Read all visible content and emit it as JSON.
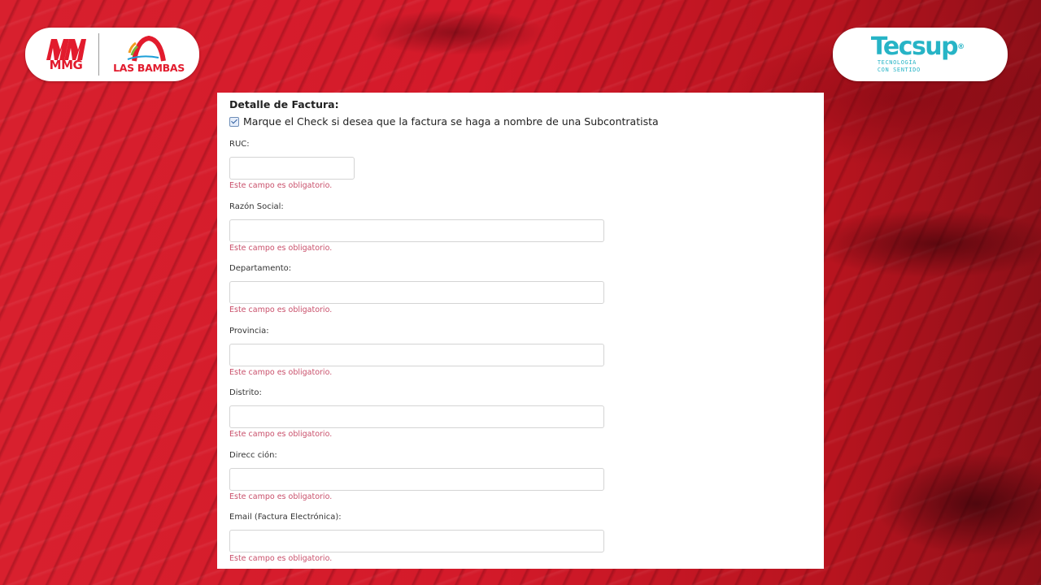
{
  "logos": {
    "left": {
      "mmg_text": "MMG",
      "bambas_text": "LAS BAMBAS"
    },
    "right": {
      "name": "Tecsup",
      "reg": "®",
      "tagline_1": "TECNOLOGÍA",
      "tagline_2": "CON SENTIDO"
    }
  },
  "form": {
    "title": "Detalle de Factura:",
    "subcontractor_check": {
      "label": "Marque el Check si desea que la factura se haga a nombre de una Subcontratista",
      "checked": true
    },
    "fields": [
      {
        "label": "RUC:",
        "value": "",
        "error": "Este campo es obligatorio."
      },
      {
        "label": "Razón Social:",
        "value": "",
        "error": "Este campo es obligatorio."
      },
      {
        "label": "Departamento:",
        "value": "",
        "error": "Este campo es obligatorio."
      },
      {
        "label": "Provincia:",
        "value": "",
        "error": "Este campo es obligatorio."
      },
      {
        "label": "Distrito:",
        "value": "",
        "error": "Este campo es obligatorio."
      },
      {
        "label": "Direcc ción:",
        "value": "",
        "error": "Este campo es obligatorio."
      },
      {
        "label": "Email (Factura Electrónica):",
        "value": "",
        "error": "Este campo es obligatorio."
      }
    ]
  },
  "colors": {
    "brand_red": "#e21b2d",
    "tecsup_teal": "#27b4c6",
    "error_text": "#c9506b",
    "background_red": "#d81d2c"
  },
  "icons": [
    "mmg-logo-icon",
    "las-bambas-arch-icon",
    "checkbox-checked-icon"
  ]
}
